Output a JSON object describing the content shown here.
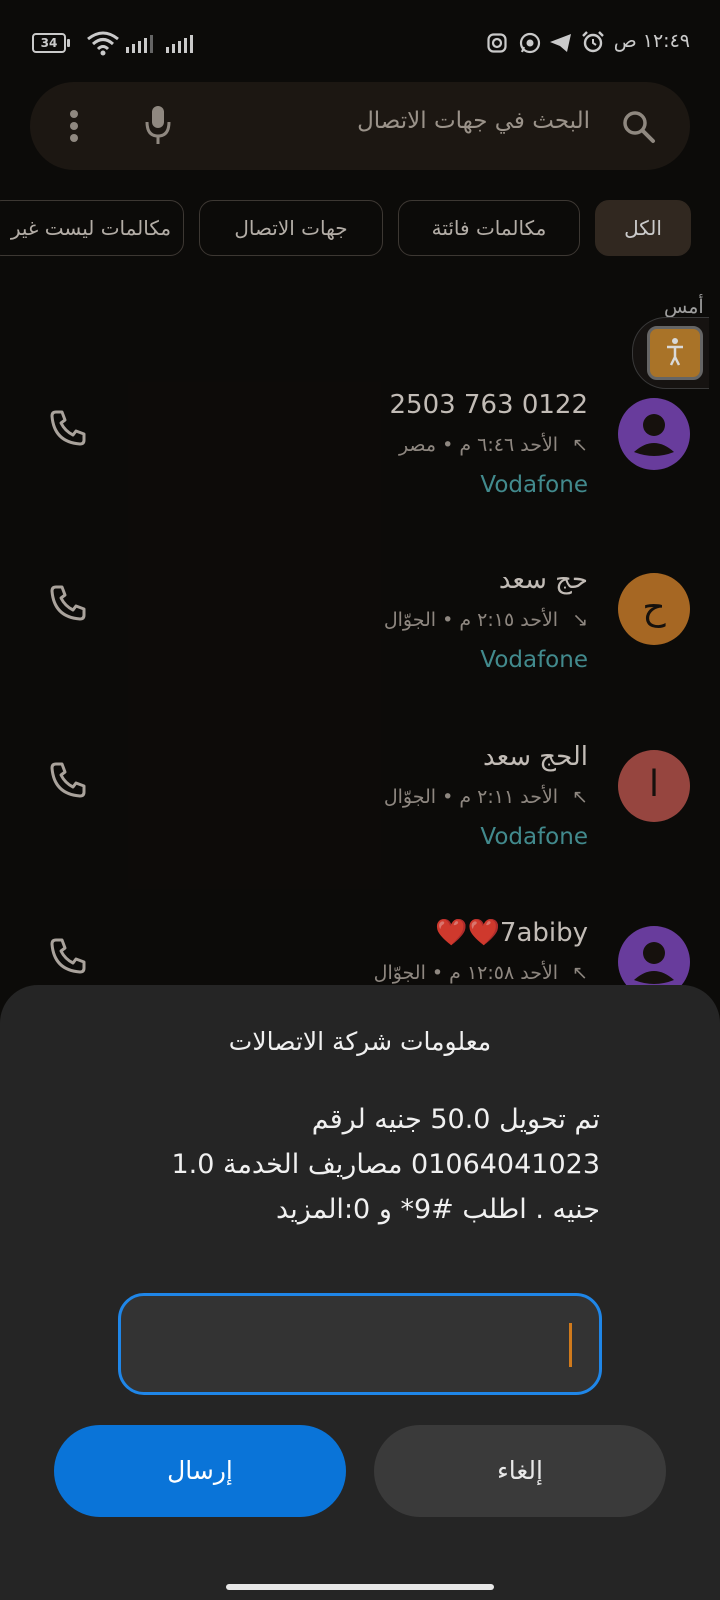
{
  "status_bar": {
    "battery": "34",
    "time": "١٢:٤٩ ص"
  },
  "search": {
    "placeholder": "البحث في جهات الاتصال"
  },
  "filters": [
    "الكل",
    "مكالمات فائتة",
    "جهات الاتصال",
    "مكالمات ليست غير"
  ],
  "section_label": "أمس",
  "calls": [
    {
      "name": "0122 763 2503",
      "detail": "الأحد ٦:٤٦ م • مصر",
      "direction": "outgoing",
      "carrier": "Vodafone",
      "avatar_letter": "",
      "avatar_color": "#7b47b8"
    },
    {
      "name": "حج سعد",
      "detail": "الأحد ٢:١٥ م • الجوّال",
      "direction": "incoming",
      "carrier": "Vodafone",
      "avatar_letter": "ح",
      "avatar_color": "#c47a2a"
    },
    {
      "name": "الحج سعد",
      "detail": "الأحد ٢:١١ م • الجوّال",
      "direction": "outgoing",
      "carrier": "Vodafone",
      "avatar_letter": "ا",
      "avatar_color": "#b1524a"
    },
    {
      "name": "7abiby❤️❤️",
      "detail": "الأحد ١٢:٥٨ م • الجوّال",
      "direction": "outgoing",
      "carrier": "",
      "avatar_letter": "",
      "avatar_color": "#7b47b8"
    }
  ],
  "dialog": {
    "title": "معلومات شركة الاتصالات",
    "message": "تم تحويل 50.0 جنيه لرقم 01064041023 مصاريف الخدمة 1.0 جنيه . اطلب #9* و 0:المزيد",
    "input_value": "",
    "send_label": "إرسال",
    "cancel_label": "إلغاء"
  },
  "colors": {
    "accent": "#0a74d8",
    "carrier_text": "#4ea3a6"
  }
}
